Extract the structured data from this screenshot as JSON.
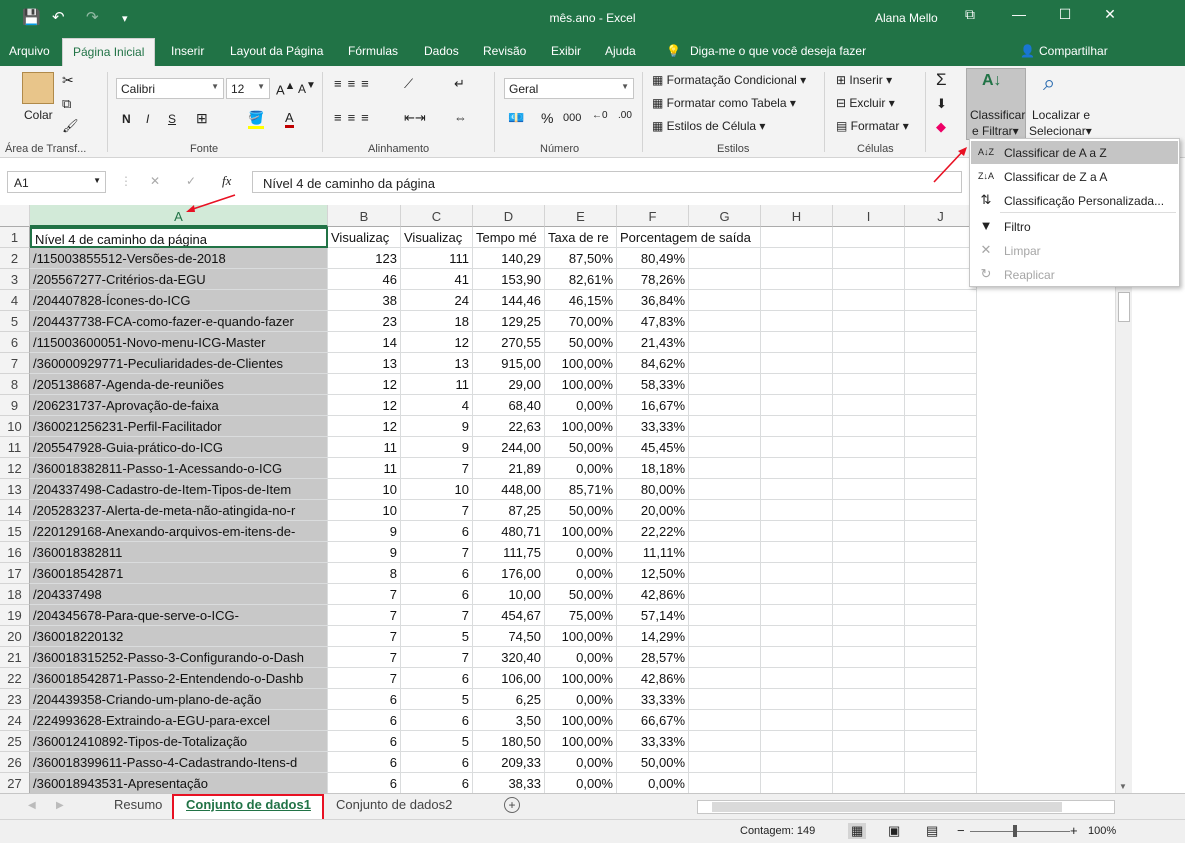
{
  "titlebar": {
    "title": "mês.ano - Excel",
    "user": "Alana Mello",
    "save_icon": "💾",
    "undo_icon": "↶",
    "redo_icon": "↷",
    "customize_icon": "▾",
    "ribbon_opts_icon": "⧉",
    "min_icon": "—",
    "max_icon": "☐",
    "close_icon": "✕"
  },
  "tabs": {
    "arquivo": "Arquivo",
    "inicial": "Página Inicial",
    "inserir": "Inserir",
    "layout": "Layout da Página",
    "formulas": "Fórmulas",
    "dados": "Dados",
    "revisao": "Revisão",
    "exibir": "Exibir",
    "ajuda": "Ajuda",
    "tell": "Diga-me o que você deseja fazer",
    "share": "Compartilhar"
  },
  "ribbon": {
    "clip": {
      "paste": "Colar",
      "label": "Área de Transf..."
    },
    "font": {
      "name": "Calibri",
      "size": "12",
      "bold": "N",
      "italic": "I",
      "underline": "S",
      "label": "Fonte"
    },
    "align": {
      "label": "Alinhamento"
    },
    "number": {
      "format": "Geral",
      "percent": "%",
      "thousands": "000",
      "label": "Número"
    },
    "styles": {
      "cond": "Formatação Condicional",
      "table": "Formatar como Tabela",
      "cell": "Estilos de Célula",
      "label": "Estilos"
    },
    "cells": {
      "insert": "Inserir",
      "delete": "Excluir",
      "format": "Formatar",
      "label": "Células"
    },
    "edit": {
      "sort": "Classificar",
      "filter": "e Filtrar",
      "find": "Localizar e",
      "select": "Selecionar"
    }
  },
  "formula": {
    "namebox": "A1",
    "content": "Nível 4 de caminho da página",
    "fx": "fx",
    "cancel": "✕",
    "enter": "✓"
  },
  "columns": [
    "A",
    "B",
    "C",
    "D",
    "E",
    "F",
    "G",
    "H",
    "I",
    "J"
  ],
  "header_row": [
    "Nível 4 de caminho da página",
    "Visualizaç",
    "Visualizaç",
    "Tempo mé",
    "Taxa de re",
    "Porcentagem de saída"
  ],
  "rows": [
    [
      "/115003855512-Versões-de-2018",
      "123",
      "111",
      "140,29",
      "87,50%",
      "80,49%"
    ],
    [
      "/205567277-Critérios-da-EGU",
      "46",
      "41",
      "153,90",
      "82,61%",
      "78,26%"
    ],
    [
      "/204407828-Ícones-do-ICG",
      "38",
      "24",
      "144,46",
      "46,15%",
      "36,84%"
    ],
    [
      "/204437738-FCA-como-fazer-e-quando-fazer",
      "23",
      "18",
      "129,25",
      "70,00%",
      "47,83%"
    ],
    [
      "/115003600051-Novo-menu-ICG-Master",
      "14",
      "12",
      "270,55",
      "50,00%",
      "21,43%"
    ],
    [
      "/360000929771-Peculiaridades-de-Clientes",
      "13",
      "13",
      "915,00",
      "100,00%",
      "84,62%"
    ],
    [
      "/205138687-Agenda-de-reuniões",
      "12",
      "11",
      "29,00",
      "100,00%",
      "58,33%"
    ],
    [
      "/206231737-Aprovação-de-faixa",
      "12",
      "4",
      "68,40",
      "0,00%",
      "16,67%"
    ],
    [
      "/360021256231-Perfil-Facilitador",
      "12",
      "9",
      "22,63",
      "100,00%",
      "33,33%"
    ],
    [
      "/205547928-Guia-prático-do-ICG",
      "11",
      "9",
      "244,00",
      "50,00%",
      "45,45%"
    ],
    [
      "/360018382811-Passo-1-Acessando-o-ICG",
      "11",
      "7",
      "21,89",
      "0,00%",
      "18,18%"
    ],
    [
      "/204337498-Cadastro-de-Item-Tipos-de-Item",
      "10",
      "10",
      "448,00",
      "85,71%",
      "80,00%"
    ],
    [
      "/205283237-Alerta-de-meta-não-atingida-no-r",
      "10",
      "7",
      "87,25",
      "50,00%",
      "20,00%"
    ],
    [
      "/220129168-Anexando-arquivos-em-itens-de-",
      "9",
      "6",
      "480,71",
      "100,00%",
      "22,22%"
    ],
    [
      "/360018382811",
      "9",
      "7",
      "111,75",
      "0,00%",
      "11,11%"
    ],
    [
      "/360018542871",
      "8",
      "6",
      "176,00",
      "0,00%",
      "12,50%"
    ],
    [
      "/204337498",
      "7",
      "6",
      "10,00",
      "50,00%",
      "42,86%"
    ],
    [
      "/204345678-Para-que-serve-o-ICG-",
      "7",
      "7",
      "454,67",
      "75,00%",
      "57,14%"
    ],
    [
      "/360018220132",
      "7",
      "5",
      "74,50",
      "100,00%",
      "14,29%"
    ],
    [
      "/360018315252-Passo-3-Configurando-o-Dash",
      "7",
      "7",
      "320,40",
      "0,00%",
      "28,57%"
    ],
    [
      "/360018542871-Passo-2-Entendendo-o-Dashb",
      "7",
      "6",
      "106,00",
      "100,00%",
      "42,86%"
    ],
    [
      "/204439358-Criando-um-plano-de-ação",
      "6",
      "5",
      "6,25",
      "0,00%",
      "33,33%"
    ],
    [
      "/224993628-Extraindo-a-EGU-para-excel",
      "6",
      "6",
      "3,50",
      "100,00%",
      "66,67%"
    ],
    [
      "/360012410892-Tipos-de-Totalização",
      "6",
      "5",
      "180,50",
      "100,00%",
      "33,33%"
    ],
    [
      "/360018399611-Passo-4-Cadastrando-Itens-d",
      "6",
      "6",
      "209,33",
      "0,00%",
      "50,00%"
    ],
    [
      "/360018943531-Apresentação",
      "6",
      "6",
      "38,33",
      "0,00%",
      "0,00%"
    ]
  ],
  "menu": [
    {
      "label": "Classificar de A a Z",
      "icon": "A↓Z",
      "disabled": false,
      "hl": true
    },
    {
      "label": "Classificar de Z a A",
      "icon": "Z↓A",
      "disabled": false,
      "hl": false
    },
    {
      "label": "Classificação Personalizada...",
      "icon": "⇅",
      "disabled": false,
      "hl": false
    },
    {
      "label": "Filtro",
      "icon": "▼",
      "disabled": false,
      "hl": false
    },
    {
      "label": "Limpar",
      "icon": "✕",
      "disabled": true,
      "hl": false
    },
    {
      "label": "Reaplicar",
      "icon": "↻",
      "disabled": true,
      "hl": false
    }
  ],
  "sheets": {
    "s1": "Resumo",
    "s2": "Conjunto de dados1",
    "s3": "Conjunto de dados2",
    "add": "+"
  },
  "status": {
    "count": "Contagem: 149",
    "zoom": "100%",
    "minus": "−",
    "plus": "+"
  },
  "colors": {
    "excel_green": "#217346",
    "highlight": "#e81123"
  }
}
